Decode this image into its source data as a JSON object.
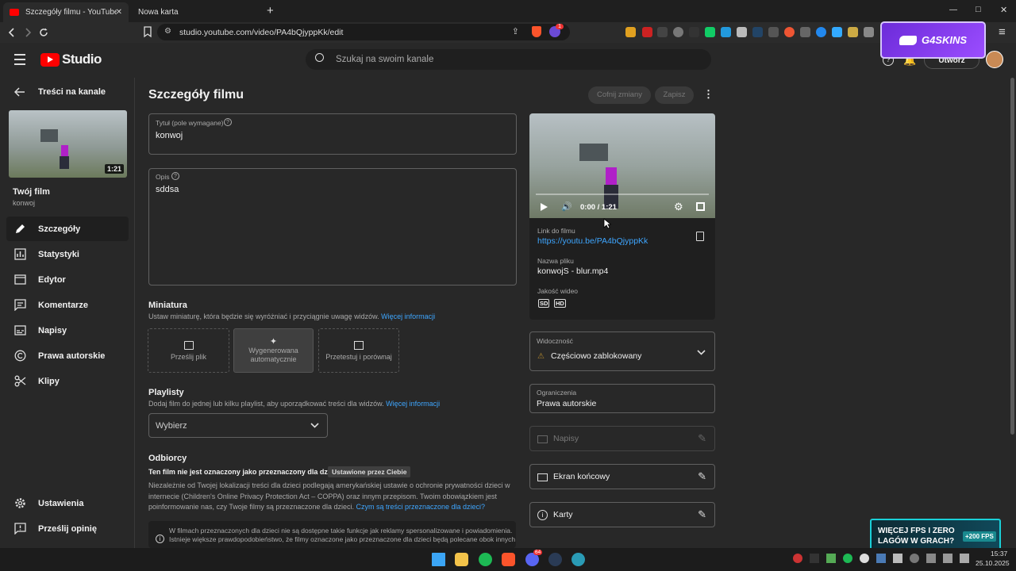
{
  "browser": {
    "tabs": [
      {
        "title": "Szczegóły filmu - YouTube Studio"
      },
      {
        "title": "Nowa karta"
      }
    ],
    "url": "studio.youtube.com/video/PA4bQjyppKk/edit",
    "new_tab": "+",
    "window_controls": [
      "—",
      "□",
      "✕"
    ],
    "brave_badge": "1"
  },
  "promo_top": {
    "text": "G4SKINS"
  },
  "header": {
    "logo_text": "Studio",
    "search_placeholder": "Szukaj na swoim kanale",
    "create_label": "Utwórz"
  },
  "sidebar": {
    "back_label": "Treści na kanale",
    "duration": "1:21",
    "film_label": "Twój film",
    "film_name": "konwoj",
    "items": [
      {
        "label": "Szczegóły",
        "icon": "pencil-icon"
      },
      {
        "label": "Statystyki",
        "icon": "analytics-icon"
      },
      {
        "label": "Edytor",
        "icon": "editor-icon"
      },
      {
        "label": "Komentarze",
        "icon": "comments-icon"
      },
      {
        "label": "Napisy",
        "icon": "subtitles-icon"
      },
      {
        "label": "Prawa autorskie",
        "icon": "copyright-icon"
      },
      {
        "label": "Klipy",
        "icon": "scissors-icon"
      }
    ],
    "bottom_items": [
      {
        "label": "Ustawienia",
        "icon": "gear-icon"
      },
      {
        "label": "Prześlij opinię",
        "icon": "feedback-icon"
      }
    ]
  },
  "main": {
    "page_title": "Szczegóły filmu",
    "undo_label": "Cofnij zmiany",
    "save_label": "Zapisz",
    "title_field": {
      "label": "Tytuł (pole wymagane)",
      "value": "konwoj"
    },
    "desc_field": {
      "label": "Opis",
      "value": "sddsa"
    },
    "thumbnail": {
      "title": "Miniatura",
      "desc": "Ustaw miniaturę, która będzie się wyróżniać i przyciągnie uwagę widzów.",
      "more": "Więcej informacji",
      "options": [
        "Prześlij plik",
        "Wygenerowana automatycznie",
        "Przetestuj i porównaj"
      ]
    },
    "playlists": {
      "title": "Playlisty",
      "desc": "Dodaj film do jednej lub kilku playlist, aby uporządkować treści dla widzów.",
      "more": "Więcej informacji",
      "select_value": "Wybierz"
    },
    "audience": {
      "title": "Odbiorcy",
      "status": "Ten film nie jest oznaczony jako przeznaczony dla dzieci",
      "badge": "Ustawione przez Ciebie",
      "text_1": "Niezależnie od Twojej lokalizacji treści dla dzieci podlegają amerykańskiej ustawie o ochronie prywatności dzieci w",
      "text_2": "internecie (Children's Online Privacy Protection Act – COPPA) oraz innym przepisom. Twoim obowiązkiem jest",
      "text_3": "poinformowanie nas, czy Twoje filmy są przeznaczone dla dzieci.",
      "link": "Czym są treści przeznaczone dla dzieci?",
      "info_1": "W filmach przeznaczonych dla dzieci nie są dostępne takie funkcje jak reklamy spersonalizowane i powiadomienia.",
      "info_2": "Istnieje większe prawdopodobieństwo, że filmy oznaczone jako przeznaczone dla dzieci będą polecane obok innych"
    }
  },
  "right": {
    "player_time": "0:00 / 1:21",
    "link_label": "Link do filmu",
    "link_value": "https://youtu.be/PA4bQjyppKk",
    "filename_label": "Nazwa pliku",
    "filename_value": "konwojS - blur.mp4",
    "quality_label": "Jakość wideo",
    "quality_badges": [
      "SD",
      "HD"
    ],
    "visibility_label": "Widoczność",
    "visibility_value": "Częściowo zablokowany",
    "restrictions_label": "Ograniczenia",
    "restrictions_value": "Prawa autorskie",
    "subtitles_label": "Napisy",
    "endscreen_label": "Ekran końcowy",
    "cards_label": "Karty"
  },
  "promo_bottom": {
    "line1": "WIĘCEJ FPS I ZERO",
    "line2": "LAGÓW W GRACH?",
    "badge": "+200 FPS"
  },
  "taskbar": {
    "time": "15:37",
    "date": "25.10.2025",
    "discord_badge": "64"
  },
  "colors": {
    "accent_link": "#3ea6ff",
    "yt_red": "#ff0000",
    "warning": "#b3892f"
  }
}
